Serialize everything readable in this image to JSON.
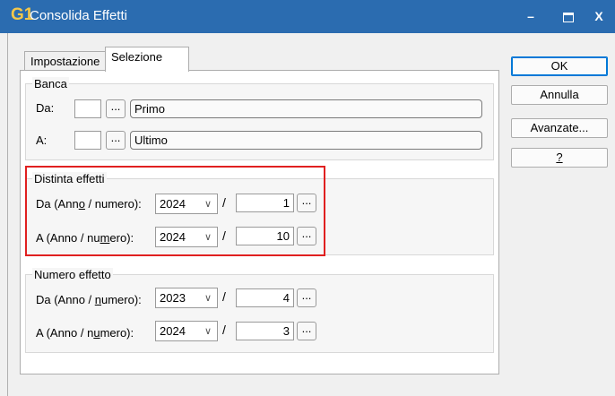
{
  "window": {
    "title": "Consolida Effetti",
    "logo": "G1",
    "minimize": "–",
    "close": "X"
  },
  "tabs": [
    {
      "label": "Impostazione"
    },
    {
      "label": "Selezione"
    }
  ],
  "banca": {
    "title": "Banca",
    "da_label": "Da:",
    "da_code": "",
    "da_name": "Primo",
    "a_label": "A:",
    "a_code": "",
    "a_name": "Ultimo"
  },
  "distinta": {
    "title": "Distinta effetti",
    "da_label_pre": "Da (Ann",
    "da_label_u": "o",
    "da_label_post": " / numero):",
    "da_year": "2024",
    "da_number": "1",
    "a_label_pre": "A (Anno / nu",
    "a_label_u": "m",
    "a_label_post": "ero):",
    "a_year": "2024",
    "a_number": "10"
  },
  "numero": {
    "title": "Numero effetto",
    "da_label_pre": "Da (Anno / ",
    "da_label_u": "n",
    "da_label_post": "umero):",
    "da_year": "2023",
    "da_number": "4",
    "a_label_pre": "A (Anno / n",
    "a_label_u": "u",
    "a_label_post": "mero):",
    "a_year": "2024",
    "a_number": "3"
  },
  "slash": "/",
  "dots": "...",
  "buttons": {
    "ok": "OK",
    "annulla": "Annulla",
    "avanzate": "Avanzate...",
    "help": "?"
  },
  "colors": {
    "titlebar": "#2b6cb0",
    "highlight": "#e02020"
  }
}
